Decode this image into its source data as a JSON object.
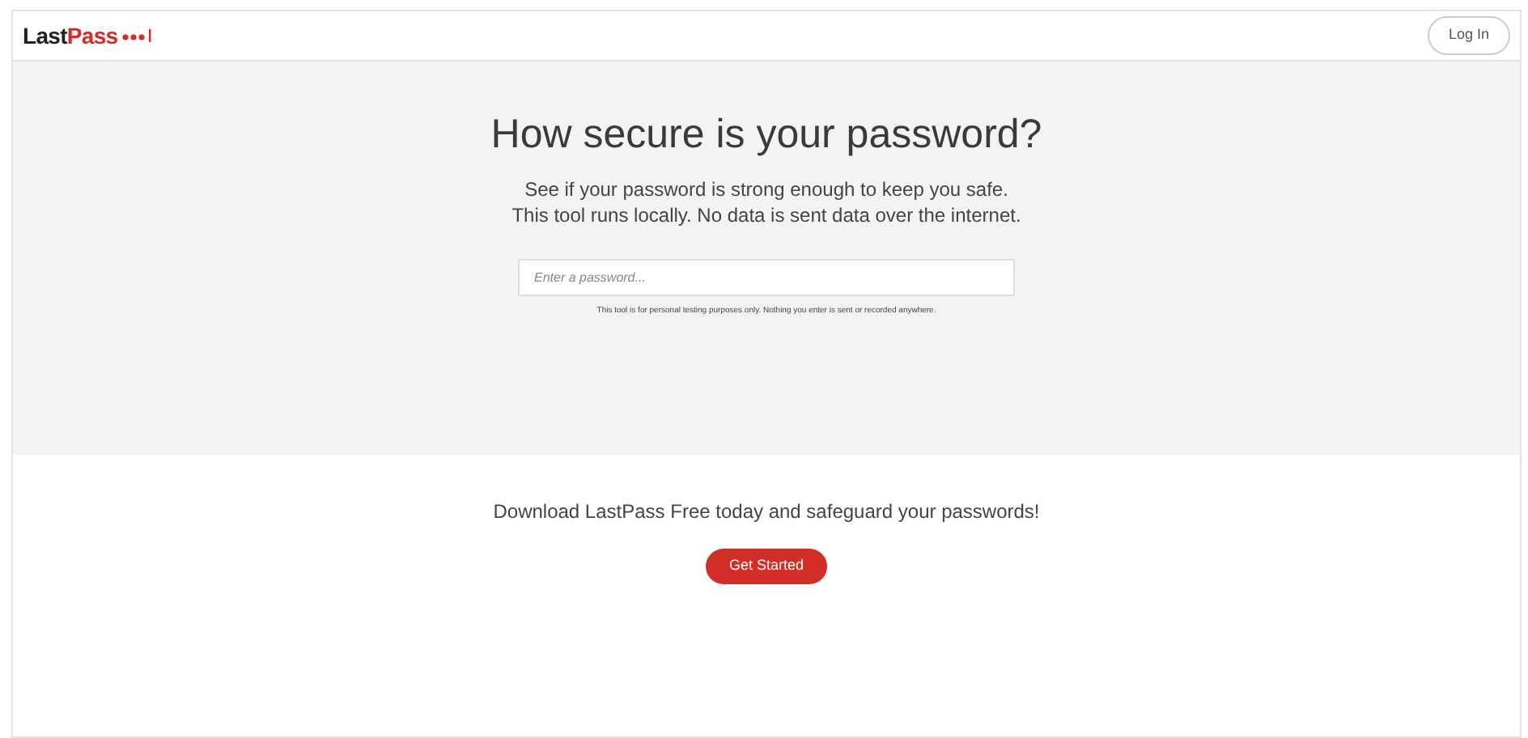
{
  "header": {
    "logo": {
      "part_1": "Last",
      "part_2": "Pass"
    },
    "login_button": "Log In"
  },
  "hero": {
    "title": "How secure is your password?",
    "subtitle": "See if your password is strong enough to keep you safe. This tool runs locally. No data is sent data over the internet.",
    "password_field": {
      "placeholder": "Enter a password..."
    },
    "disclaimer": "This tool is for personal testing purposes only. Nothing you enter is sent or recorded anywhere."
  },
  "promo": {
    "text": "Download LastPass Free today and safeguard your passwords!",
    "button": "Get Started"
  }
}
